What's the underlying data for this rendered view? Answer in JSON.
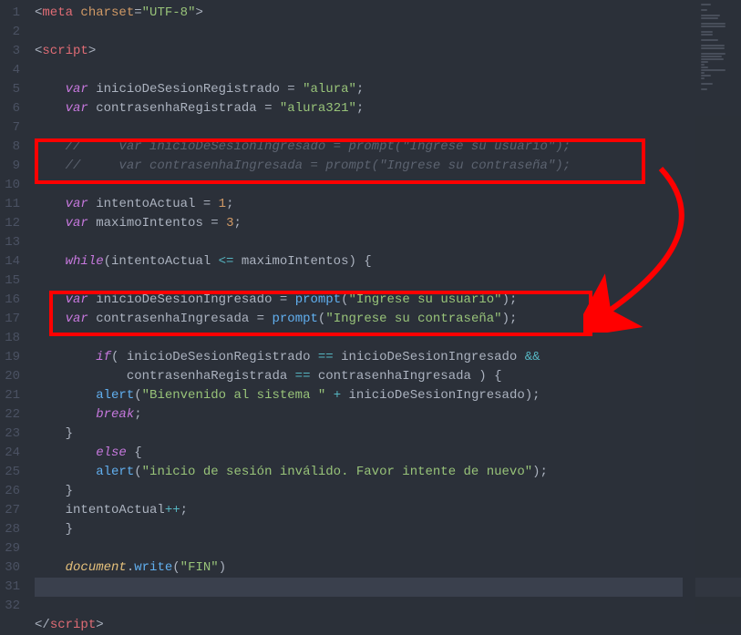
{
  "lines": [
    {
      "n": "1"
    },
    {
      "n": "2"
    },
    {
      "n": "3"
    },
    {
      "n": "4"
    },
    {
      "n": "5"
    },
    {
      "n": "6"
    },
    {
      "n": "7"
    },
    {
      "n": "8"
    },
    {
      "n": "9"
    },
    {
      "n": "10"
    },
    {
      "n": "11"
    },
    {
      "n": "12"
    },
    {
      "n": "13"
    },
    {
      "n": "14"
    },
    {
      "n": "15"
    },
    {
      "n": "16"
    },
    {
      "n": "17"
    },
    {
      "n": "18"
    },
    {
      "n": "19"
    },
    {
      "n": "20"
    },
    {
      "n": "21"
    },
    {
      "n": "22"
    },
    {
      "n": "23"
    },
    {
      "n": "24"
    },
    {
      "n": "25"
    },
    {
      "n": "26"
    },
    {
      "n": "27"
    },
    {
      "n": "28"
    },
    {
      "n": "29"
    },
    {
      "n": "30"
    },
    {
      "n": "31"
    },
    {
      "n": "32"
    }
  ],
  "code": {
    "l1": {
      "open": "<",
      "tag": "meta",
      "sp": " ",
      "attr": "charset",
      "eq": "=",
      "q1": "\"",
      "val": "UTF-8",
      "q2": "\"",
      "close": ">"
    },
    "l3": {
      "open": "<",
      "tag": "script",
      "close": ">"
    },
    "l5": {
      "kw": "var",
      "sp": " ",
      "name": "inicioDeSesionRegistrado",
      "eq": " = ",
      "q1": "\"",
      "val": "alura",
      "q2": "\"",
      "semi": ";"
    },
    "l6": {
      "kw": "var",
      "sp": " ",
      "name": "contrasenhaRegistrada",
      "eq": " = ",
      "q1": "\"",
      "val": "alura321",
      "q2": "\"",
      "semi": ";"
    },
    "l8": {
      "text": "//     var inicioDeSesionIngresado = prompt(\"Ingrese su usuario\");"
    },
    "l9": {
      "text": "//     var contrasenhaIngresada = prompt(\"Ingrese su contraseña\");"
    },
    "l11": {
      "kw": "var",
      "sp": " ",
      "name": "intentoActual",
      "eq": " = ",
      "val": "1",
      "semi": ";"
    },
    "l12": {
      "kw": "var",
      "sp": " ",
      "name": "maximoIntentos",
      "eq": " = ",
      "val": "3",
      "semi": ";"
    },
    "l14": {
      "kw": "while",
      "open": "(",
      "a": "intentoActual",
      "op": " <= ",
      "b": "maximoIntentos",
      "close": ")",
      "brace": " {"
    },
    "l16": {
      "kw": "var",
      "sp": " ",
      "name": "inicioDeSesionIngresado",
      "eq": " = ",
      "fn": "prompt",
      "open": "(",
      "q1": "\"",
      "val": "Ingrese su usuario",
      "q2": "\"",
      "close": ")",
      "semi": ";"
    },
    "l17": {
      "kw": "var",
      "sp": " ",
      "name": "contrasenhaIngresada",
      "eq": " = ",
      "fn": "prompt",
      "open": "(",
      "q1": "\"",
      "val": "Ingrese su contraseña",
      "q2": "\"",
      "close": ")",
      "semi": ";"
    },
    "l19": {
      "kw": "if",
      "open": "( ",
      "a": "inicioDeSesionRegistrado",
      "op1": " == ",
      "b": "inicioDeSesionIngresado",
      "op2": " &&"
    },
    "l20": {
      "a": "contrasenhaRegistrada",
      "op": " == ",
      "b": "contrasenhaIngresada",
      "close": " )",
      "brace": " {"
    },
    "l21": {
      "fn": "alert",
      "open": "(",
      "q1": "\"",
      "val": "Bienvenido al sistema ",
      "q2": "\"",
      "plus": " + ",
      "var": "inicioDeSesionIngresado",
      "close": ")",
      "semi": ";"
    },
    "l22": {
      "kw": "break",
      "semi": ";"
    },
    "l23": {
      "brace": "}"
    },
    "l24": {
      "kw": "else",
      "brace": " {"
    },
    "l25": {
      "fn": "alert",
      "open": "(",
      "q1": "\"",
      "val": "inicio de sesión inválido. Favor intente de nuevo",
      "q2": "\"",
      "close": ")",
      "semi": ";"
    },
    "l26": {
      "brace": "}"
    },
    "l27": {
      "var": "intentoActual",
      "op": "++",
      "semi": ";"
    },
    "l28": {
      "brace": "}"
    },
    "l30": {
      "obj": "document",
      "dot": ".",
      "fn": "write",
      "open": "(",
      "q1": "\"",
      "val": "FIN",
      "q2": "\"",
      "close": ")"
    },
    "l32": {
      "open": "</",
      "tag": "script",
      "close": ">"
    }
  }
}
